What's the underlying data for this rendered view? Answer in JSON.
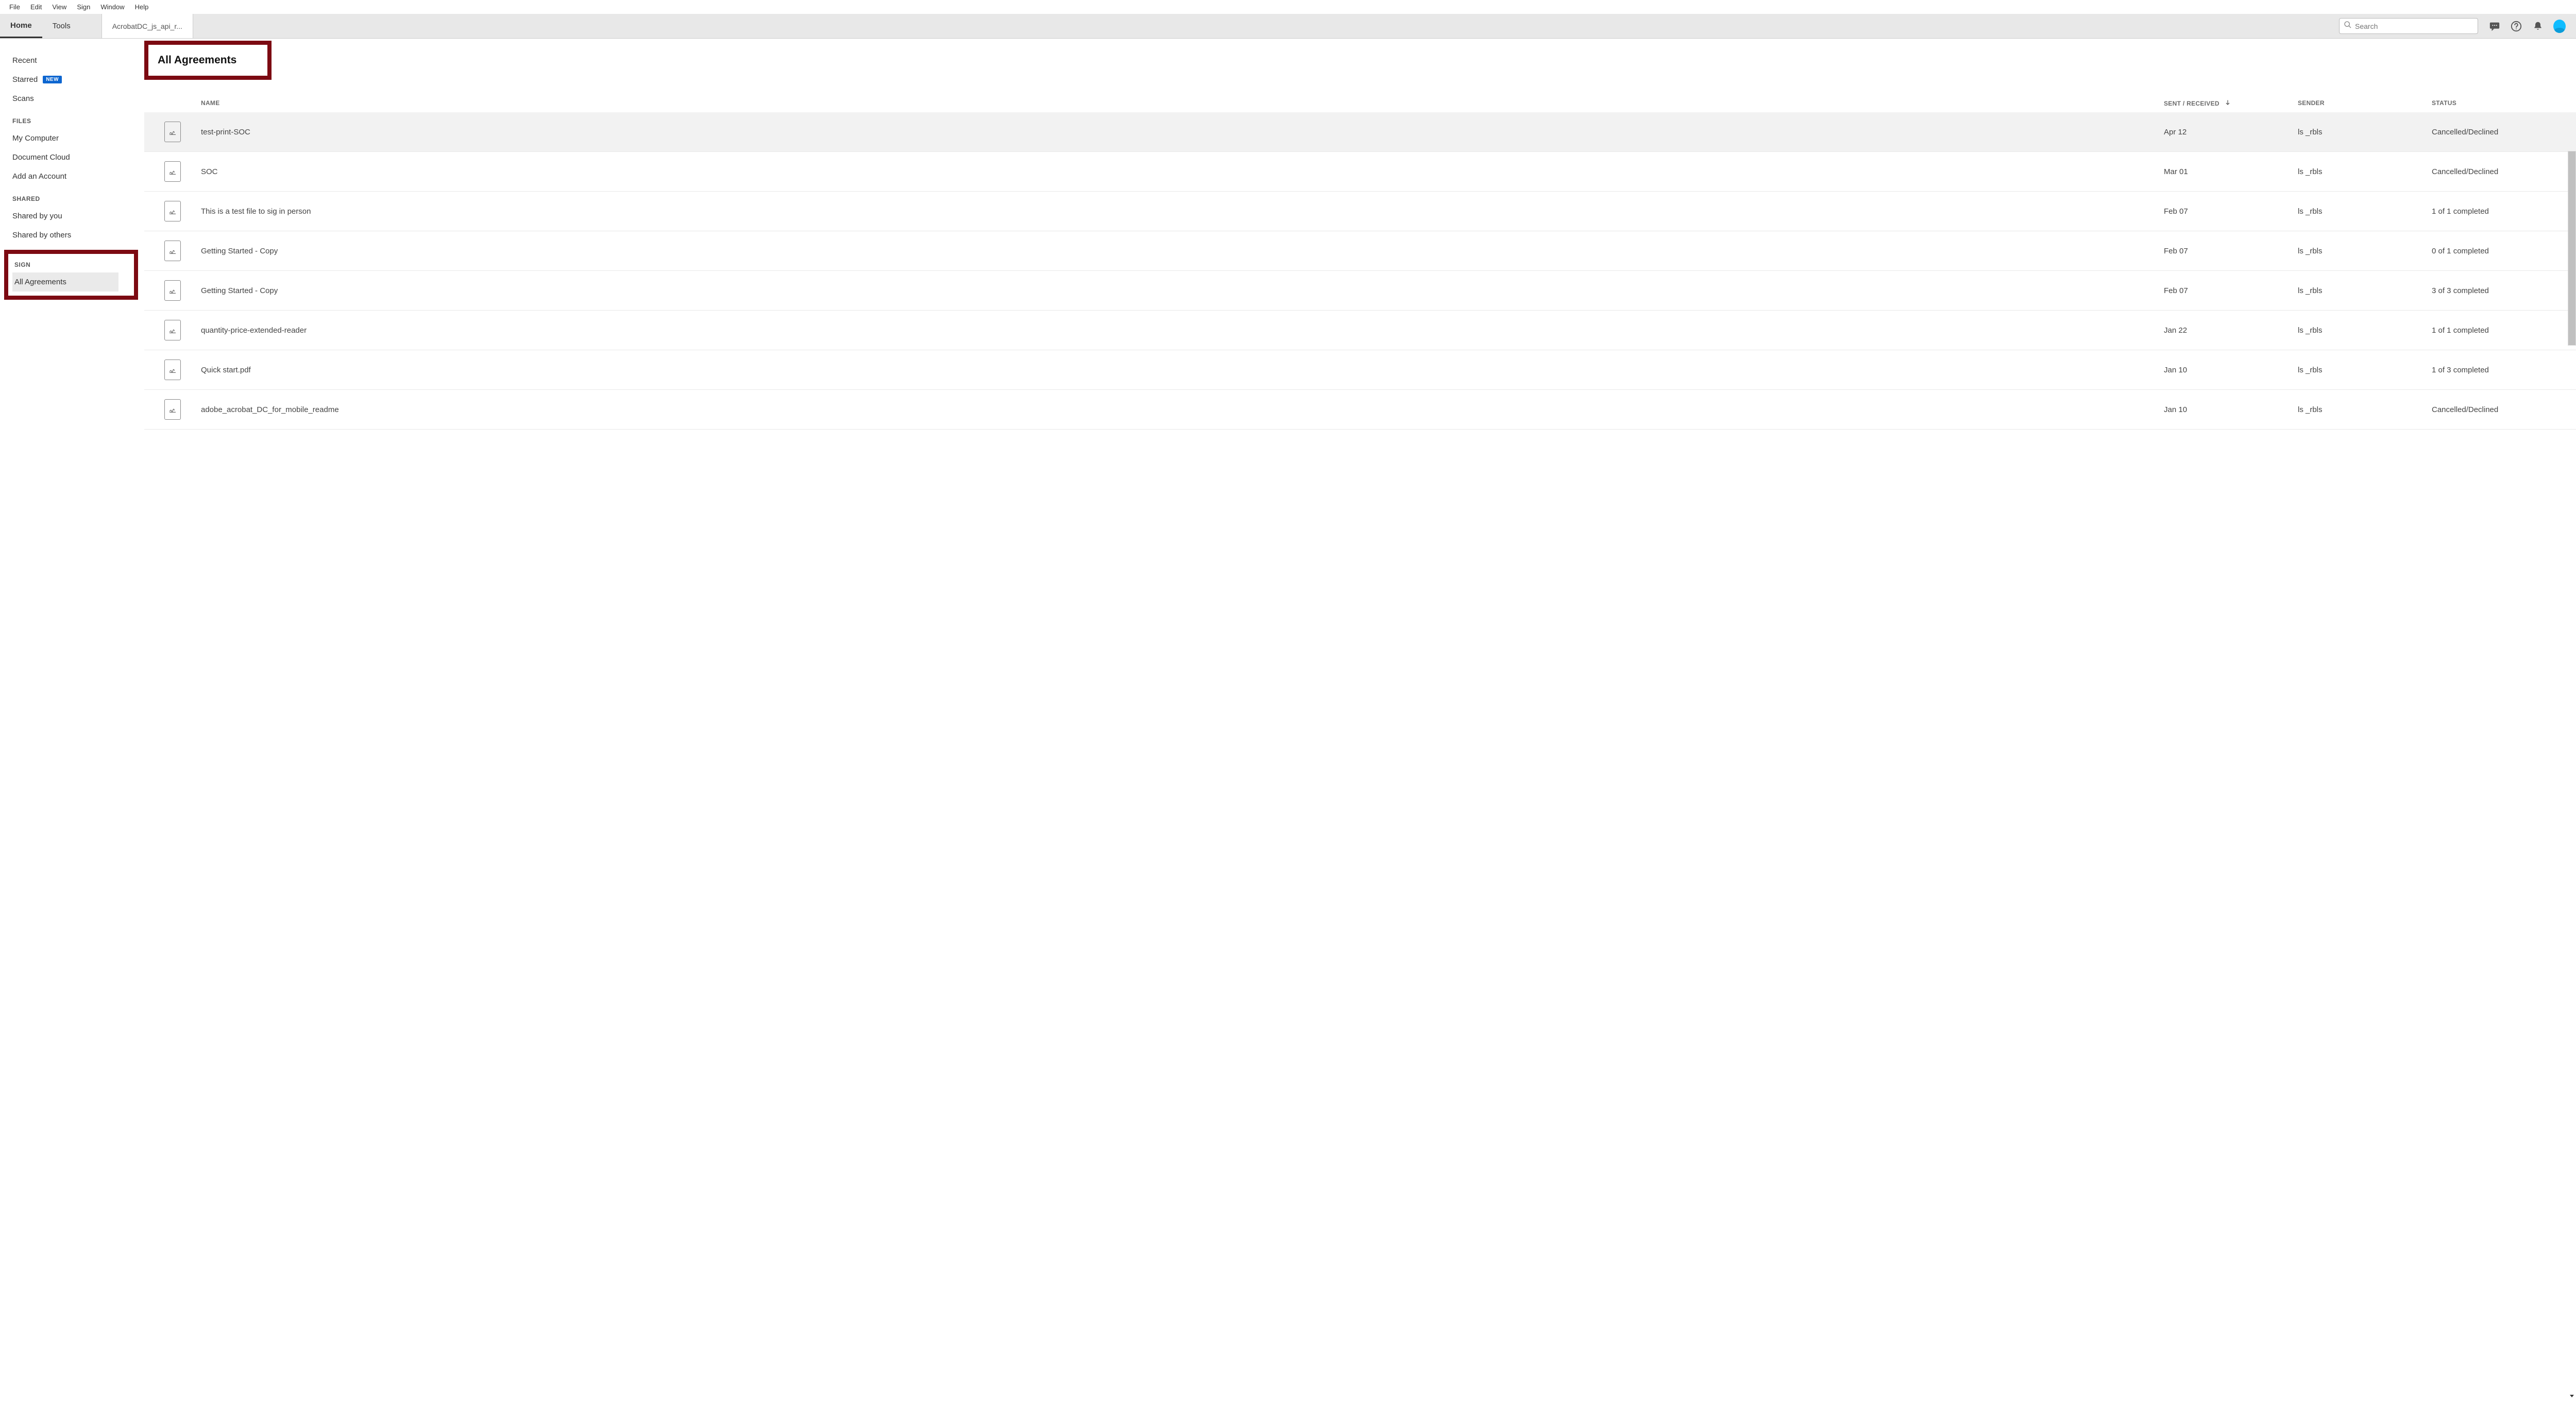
{
  "menubar": [
    "File",
    "Edit",
    "View",
    "Sign",
    "Window",
    "Help"
  ],
  "tabs": {
    "home": "Home",
    "tools": "Tools",
    "doc_tab": "AcrobatDC_js_api_r..."
  },
  "search": {
    "placeholder": "Search"
  },
  "sidebar": {
    "recent": "Recent",
    "starred": "Starred",
    "new_badge": "NEW",
    "scans": "Scans",
    "files_heading": "FILES",
    "my_computer": "My Computer",
    "document_cloud": "Document Cloud",
    "add_account": "Add an Account",
    "shared_heading": "SHARED",
    "shared_by_you": "Shared by you",
    "shared_by_others": "Shared by others",
    "sign_heading": "SIGN",
    "all_agreements": "All Agreements"
  },
  "page_title": "All Agreements",
  "columns": {
    "name": "NAME",
    "sent_received": "SENT / RECEIVED",
    "sender": "SENDER",
    "status": "STATUS"
  },
  "rows": [
    {
      "name": "test-print-SOC",
      "date": "Apr 12",
      "sender": "ls _rbls",
      "status": "Cancelled/Declined"
    },
    {
      "name": "SOC",
      "date": "Mar 01",
      "sender": "ls _rbls",
      "status": "Cancelled/Declined"
    },
    {
      "name": "This is a test file to sig in person",
      "date": "Feb 07",
      "sender": "ls _rbls",
      "status": "1 of 1 completed"
    },
    {
      "name": "Getting Started - Copy",
      "date": "Feb 07",
      "sender": "ls _rbls",
      "status": "0 of 1 completed"
    },
    {
      "name": "Getting Started - Copy",
      "date": "Feb 07",
      "sender": "ls _rbls",
      "status": "3 of 3 completed"
    },
    {
      "name": "quantity-price-extended-reader",
      "date": "Jan 22",
      "sender": "ls _rbls",
      "status": "1 of 1 completed"
    },
    {
      "name": "Quick start.pdf",
      "date": "Jan 10",
      "sender": "ls _rbls",
      "status": "1 of 3 completed"
    },
    {
      "name": "adobe_acrobat_DC_for_mobile_readme",
      "date": "Jan 10",
      "sender": "ls _rbls",
      "status": "Cancelled/Declined"
    }
  ]
}
